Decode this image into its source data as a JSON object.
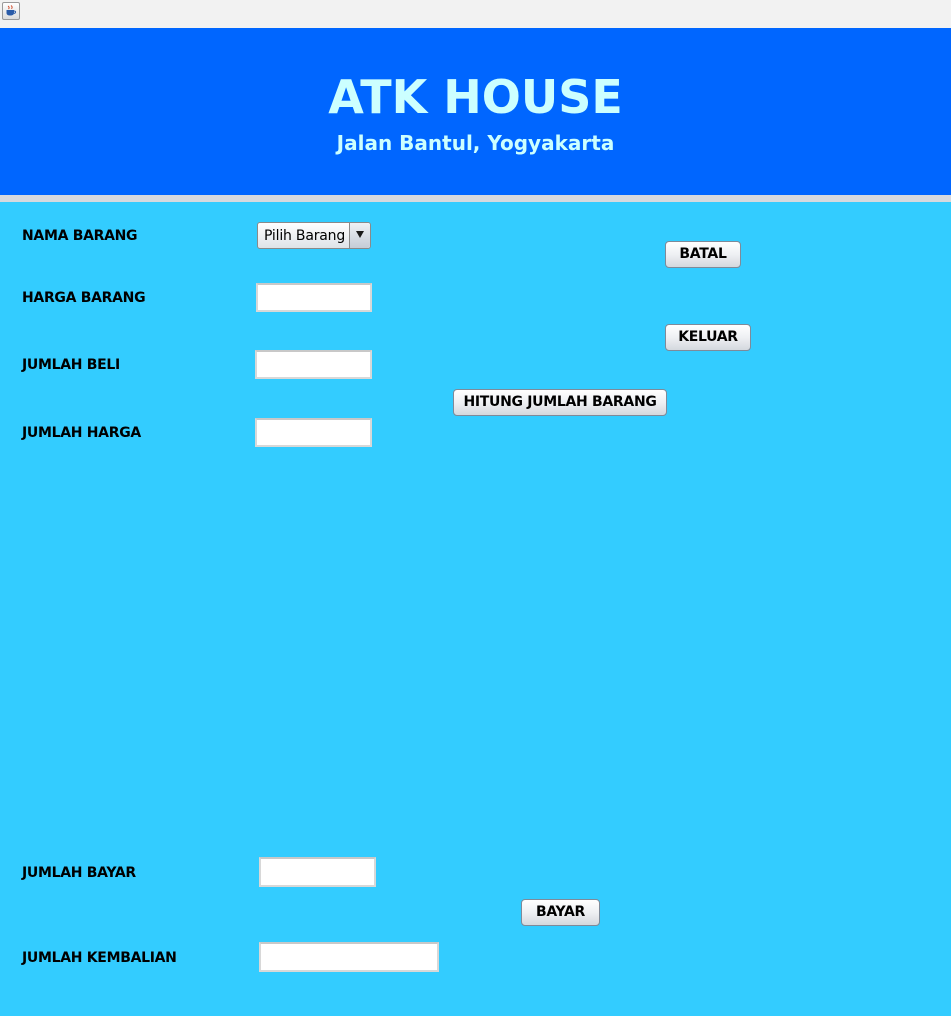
{
  "header": {
    "title": "ATK HOUSE",
    "subtitle": "Jalan Bantul, Yogyakarta"
  },
  "form": {
    "nama_barang_label": "NAMA BARANG",
    "nama_barang_selected": "Pilih Barang",
    "harga_barang_label": "HARGA BARANG",
    "harga_barang_value": "",
    "jumlah_beli_label": "JUMLAH BELI",
    "jumlah_beli_value": "",
    "jumlah_harga_label": "JUMLAH HARGA",
    "jumlah_harga_value": "",
    "jumlah_bayar_label": "JUMLAH BAYAR",
    "jumlah_bayar_value": "",
    "jumlah_kembalian_label": "JUMLAH KEMBALIAN",
    "jumlah_kembalian_value": ""
  },
  "buttons": {
    "batal": "BATAL",
    "keluar": "KELUAR",
    "hitung": "HITUNG JUMLAH BARANG",
    "bayar": "BAYAR"
  },
  "icons": {
    "app": "java-coffee-cup-icon",
    "dropdown": "triangle-down-icon"
  },
  "colors": {
    "background": "#33ccff",
    "header_background": "#0066ff",
    "header_text": "#ccffff"
  }
}
